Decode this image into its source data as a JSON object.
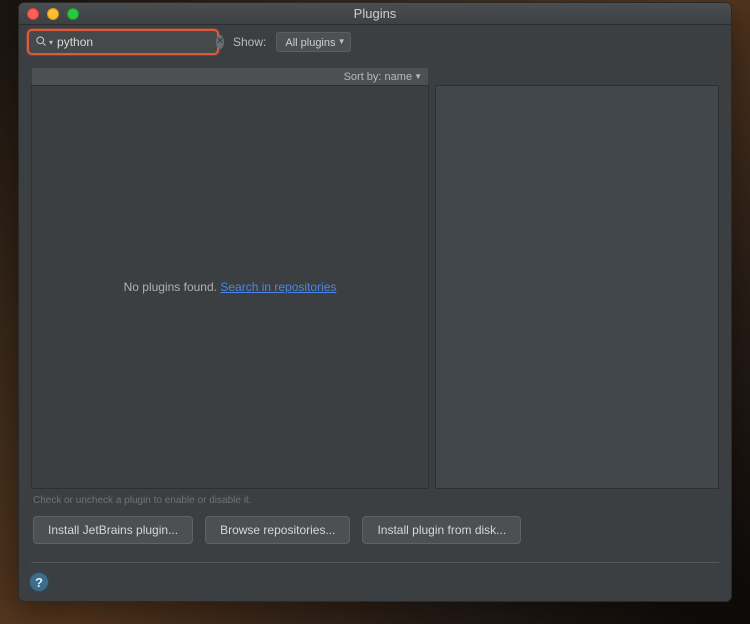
{
  "window": {
    "title": "Plugins"
  },
  "search": {
    "value": "python",
    "placeholder": ""
  },
  "show": {
    "label": "Show:",
    "selected": "All plugins"
  },
  "sort": {
    "label": "Sort by:",
    "by": "name"
  },
  "empty": {
    "text": "No plugins found.",
    "link": "Search in repositories"
  },
  "hint": "Check or uncheck a plugin to enable or disable it.",
  "buttons": {
    "install_jetbrains": "Install JetBrains plugin...",
    "browse": "Browse repositories...",
    "install_disk": "Install plugin from disk..."
  },
  "colors": {
    "highlight_border": "#e05a3a",
    "link": "#4a86e8",
    "bg": "#3c3f41"
  }
}
